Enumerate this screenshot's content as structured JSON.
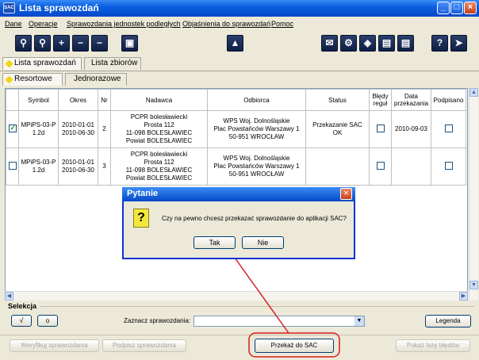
{
  "window": {
    "title": "Lista sprawozdań",
    "icon": "SAC"
  },
  "menu": [
    "Dane",
    "Operacje",
    "Sprawozdania jednostek podległych",
    "Objaśnienia do sprawozdań",
    "Pomoc"
  ],
  "toolbar": {
    "left_icons": [
      "search-icon",
      "search-alt-icon",
      "plus-icon",
      "minus-icon",
      "save-icon",
      "stamp-icon"
    ],
    "right_icons": [
      "mail-icon",
      "settings-icon",
      "network-icon",
      "book-icon",
      "document-icon",
      "help-icon",
      "exit-icon"
    ]
  },
  "tabs_main": [
    "Lista sprawozdań",
    "Lista zbiorów"
  ],
  "tabs_sub": [
    "Resortowe",
    "Jednorazowe"
  ],
  "columns": [
    "Symbol",
    "Okres",
    "Nr",
    "Nadawca",
    "Odbiorca",
    "Status",
    "Błędy reguł",
    "Data przekazania",
    "Podpisano"
  ],
  "rows": [
    {
      "checked": true,
      "symbol": [
        "MPiPS-03-P",
        "1.2d"
      ],
      "okres": [
        "2010-01-01",
        "2010-06-30"
      ],
      "nr": "2",
      "nadawca": [
        "PCPR bolesławiecki",
        "Prosta 112",
        "11-098 BOLESŁAWIEC",
        "Powiat BOLESŁAWIEC"
      ],
      "odbiorca": [
        "WPS Woj. Dolnośląskie",
        "Plac Powstańców Warszawy 1",
        "50-951 WROCŁAW"
      ],
      "status": [
        "Przekazanie SAC",
        "OK"
      ],
      "data": "2010-09-03"
    },
    {
      "checked": false,
      "symbol": [
        "MPiPS-03-P",
        "1.2d"
      ],
      "okres": [
        "2010-01-01",
        "2010-06-30"
      ],
      "nr": "3",
      "nadawca": [
        "PCPR bolesławiecki",
        "Prosta 112",
        "11-098 BOLESŁAWIEC",
        "Powiat BOLESŁAWIEC"
      ],
      "odbiorca": [
        "WPS Woj. Dolnośląskie",
        "Plac Powstańców Warszawy 1",
        "50-951 WROCŁAW"
      ],
      "status": [
        "",
        ""
      ],
      "data": ""
    }
  ],
  "selekcja": {
    "label": "Selekcja",
    "btn_check": "√",
    "btn_circle": "o",
    "zaznacz_label": "Zaznacz sprawozdania:",
    "combo_value": "",
    "legenda": "Legenda"
  },
  "bottom": {
    "weryfikuj": "Weryfikuj sprawozdania",
    "podpisz": "Podpisz sprawozdania",
    "przekaz": "Przekaż do SAC",
    "pokaz": "Pokaż listę błędów"
  },
  "dialog": {
    "title": "Pytanie",
    "message": "Czy na pewno chcesz przekazać sprawozdanie do aplikacji SAC?",
    "yes": "Tak",
    "no": "Nie",
    "icon": "?"
  },
  "colors": {
    "annotation": "#d42020",
    "titlebar": "#0a5fe0"
  }
}
